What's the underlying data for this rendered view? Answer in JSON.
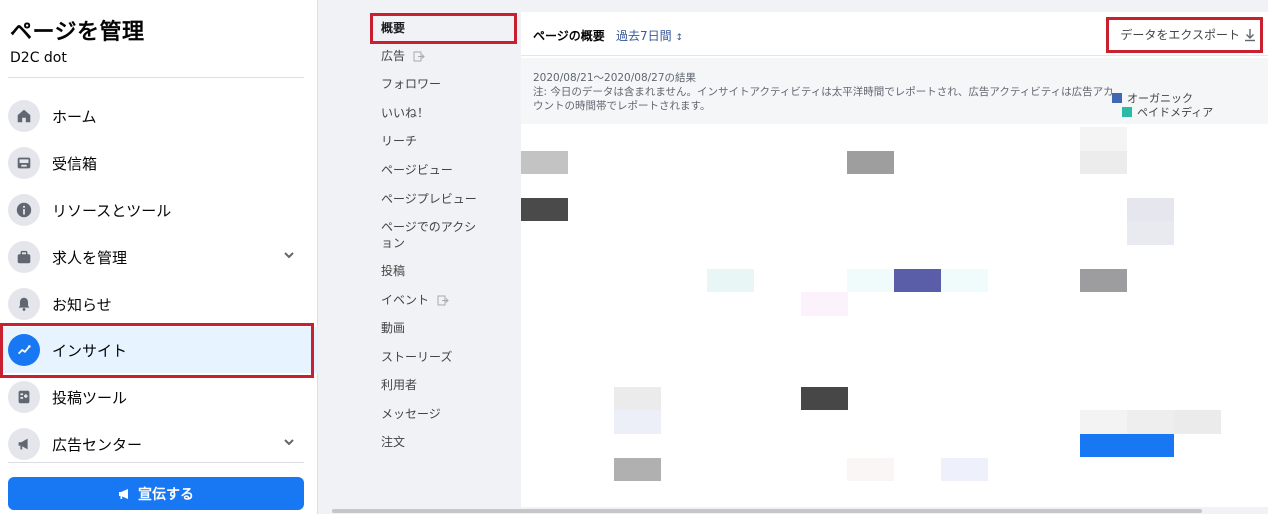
{
  "sidebar": {
    "title": "ページを管理",
    "page_name": "D2C dot",
    "items": [
      {
        "label": "ホーム"
      },
      {
        "label": "受信箱"
      },
      {
        "label": "リソースとツール"
      },
      {
        "label": "求人を管理"
      },
      {
        "label": "お知らせ"
      },
      {
        "label": "インサイト"
      },
      {
        "label": "投稿ツール"
      },
      {
        "label": "広告センター"
      }
    ],
    "promote_label": "宣伝する"
  },
  "submenu": {
    "items": [
      {
        "label": "概要"
      },
      {
        "label": "広告"
      },
      {
        "label": "フォロワー"
      },
      {
        "label": "いいね！"
      },
      {
        "label": "リーチ"
      },
      {
        "label": "ページビュー"
      },
      {
        "label": "ページプレビュー"
      },
      {
        "label": "ページでのアクション"
      },
      {
        "label": "投稿"
      },
      {
        "label": "イベント"
      },
      {
        "label": "動画"
      },
      {
        "label": "ストーリーズ"
      },
      {
        "label": "利用者"
      },
      {
        "label": "メッセージ"
      },
      {
        "label": "注文"
      }
    ]
  },
  "main": {
    "title": "ページの概要",
    "date_range": "過去7日間",
    "export_label": "データをエクスポート",
    "note_date": "2020/08/21～2020/08/27の結果",
    "note_text": "注: 今日のデータは含まれません。インサイトアクティビティは太平洋時間でレポートされ、広告アクティビティは広告アカウントの時間帯でレポートされます。",
    "legend": [
      {
        "label": "オーガニック",
        "color": "#4267b2"
      },
      {
        "label": "ペイドメディア",
        "color": "#2abba7"
      }
    ]
  },
  "colors": {
    "accent": "#1877f2",
    "highlight": "#c8202e"
  }
}
